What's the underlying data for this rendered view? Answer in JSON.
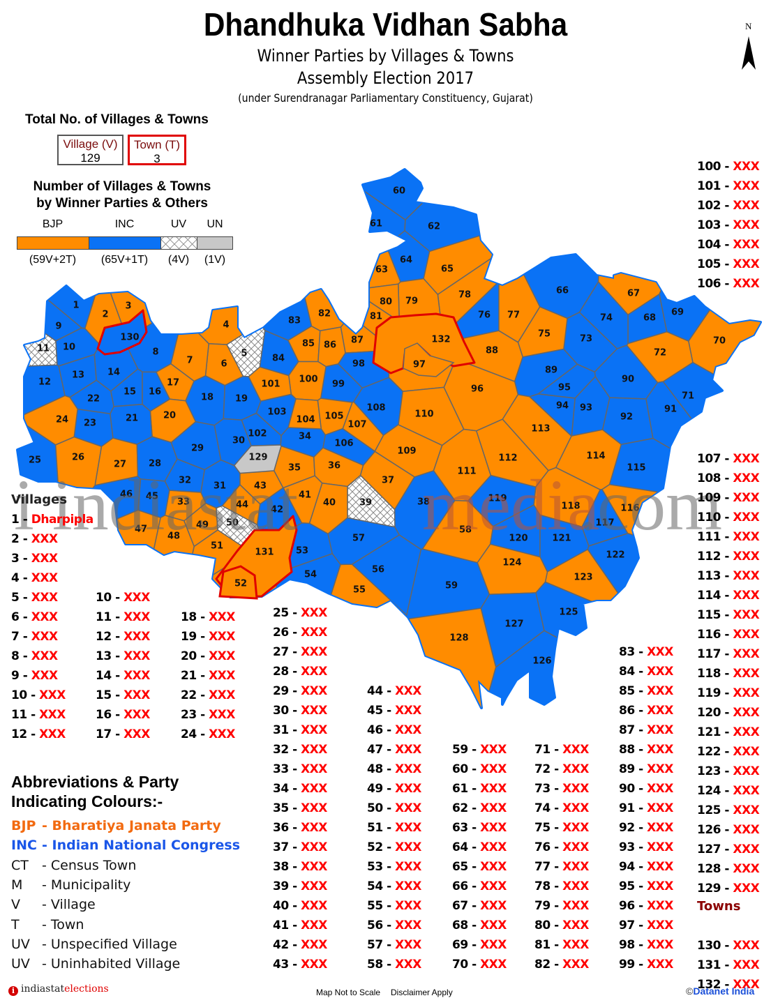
{
  "header": {
    "title": "Dhandhuka Vidhan Sabha",
    "subtitle1": "Winner Parties by Villages & Towns",
    "subtitle2": "Assembly Election 2017",
    "subtitle3": "(under Surendranagar Parliamentary Constituency, Gujarat)",
    "north_label": "N"
  },
  "totals": {
    "heading": "Total No. of Villages & Towns",
    "village_label": "Village (V)",
    "village_count": "129",
    "town_label": "Town (T)",
    "town_count": "3"
  },
  "party_summary": {
    "heading_line1": "Number of Villages & Towns",
    "heading_line2": "by Winner Parties & Others",
    "segments": [
      {
        "label": "BJP",
        "count": "(59V+2T)",
        "villages": 59,
        "towns": 2,
        "color": "#ff8c00",
        "pattern": "solid"
      },
      {
        "label": "INC",
        "count": "(65V+1T)",
        "villages": 65,
        "towns": 1,
        "color": "#0a72f5",
        "pattern": "solid"
      },
      {
        "label": "UV",
        "count": "(4V)",
        "villages": 4,
        "towns": 0,
        "color": "#ffffff",
        "pattern": "hatch"
      },
      {
        "label": "UN",
        "count": "(1V)",
        "villages": 1,
        "towns": 0,
        "color": "#c8c8c8",
        "pattern": "solid"
      }
    ]
  },
  "colors": {
    "BJP": "#ff8c00",
    "INC": "#0a72f5",
    "UV": "#ffffff",
    "UN": "#c8c8c8",
    "town_border": "#e00000",
    "region_border": "#666666",
    "outer_border": "#0a72f5"
  },
  "map": {
    "regions": [
      {
        "id": 1,
        "party": "INC"
      },
      {
        "id": 2,
        "party": "BJP"
      },
      {
        "id": 3,
        "party": "BJP"
      },
      {
        "id": 4,
        "party": "BJP"
      },
      {
        "id": 5,
        "party": "UV"
      },
      {
        "id": 6,
        "party": "BJP"
      },
      {
        "id": 7,
        "party": "BJP"
      },
      {
        "id": 8,
        "party": "INC"
      },
      {
        "id": 9,
        "party": "INC"
      },
      {
        "id": 10,
        "party": "INC"
      },
      {
        "id": 11,
        "party": "UV"
      },
      {
        "id": 12,
        "party": "INC"
      },
      {
        "id": 13,
        "party": "INC"
      },
      {
        "id": 14,
        "party": "INC"
      },
      {
        "id": 15,
        "party": "INC"
      },
      {
        "id": 16,
        "party": "INC"
      },
      {
        "id": 17,
        "party": "BJP"
      },
      {
        "id": 18,
        "party": "INC"
      },
      {
        "id": 19,
        "party": "INC"
      },
      {
        "id": 20,
        "party": "BJP"
      },
      {
        "id": 21,
        "party": "INC"
      },
      {
        "id": 22,
        "party": "INC"
      },
      {
        "id": 23,
        "party": "INC"
      },
      {
        "id": 24,
        "party": "BJP"
      },
      {
        "id": 25,
        "party": "INC"
      },
      {
        "id": 26,
        "party": "BJP"
      },
      {
        "id": 27,
        "party": "BJP"
      },
      {
        "id": 28,
        "party": "INC"
      },
      {
        "id": 29,
        "party": "INC"
      },
      {
        "id": 30,
        "party": "INC"
      },
      {
        "id": 31,
        "party": "INC"
      },
      {
        "id": 32,
        "party": "INC"
      },
      {
        "id": 33,
        "party": "BJP"
      },
      {
        "id": 34,
        "party": "INC"
      },
      {
        "id": 35,
        "party": "BJP"
      },
      {
        "id": 36,
        "party": "BJP"
      },
      {
        "id": 37,
        "party": "BJP"
      },
      {
        "id": 38,
        "party": "INC"
      },
      {
        "id": 39,
        "party": "UV"
      },
      {
        "id": 40,
        "party": "BJP"
      },
      {
        "id": 41,
        "party": "BJP"
      },
      {
        "id": 42,
        "party": "INC"
      },
      {
        "id": 43,
        "party": "BJP"
      },
      {
        "id": 44,
        "party": "BJP"
      },
      {
        "id": 45,
        "party": "INC"
      },
      {
        "id": 46,
        "party": "INC"
      },
      {
        "id": 47,
        "party": "BJP"
      },
      {
        "id": 48,
        "party": "BJP"
      },
      {
        "id": 49,
        "party": "BJP"
      },
      {
        "id": 50,
        "party": "UV"
      },
      {
        "id": 51,
        "party": "BJP"
      },
      {
        "id": 52,
        "party": "BJP"
      },
      {
        "id": 53,
        "party": "INC"
      },
      {
        "id": 54,
        "party": "INC"
      },
      {
        "id": 55,
        "party": "BJP"
      },
      {
        "id": 56,
        "party": "INC"
      },
      {
        "id": 57,
        "party": "INC"
      },
      {
        "id": 58,
        "party": "BJP"
      },
      {
        "id": 59,
        "party": "INC"
      },
      {
        "id": 60,
        "party": "INC"
      },
      {
        "id": 61,
        "party": "INC"
      },
      {
        "id": 62,
        "party": "INC"
      },
      {
        "id": 63,
        "party": "BJP"
      },
      {
        "id": 64,
        "party": "INC"
      },
      {
        "id": 65,
        "party": "BJP"
      },
      {
        "id": 66,
        "party": "INC"
      },
      {
        "id": 67,
        "party": "BJP"
      },
      {
        "id": 68,
        "party": "INC"
      },
      {
        "id": 69,
        "party": "INC"
      },
      {
        "id": 70,
        "party": "BJP"
      },
      {
        "id": 71,
        "party": "INC"
      },
      {
        "id": 72,
        "party": "BJP"
      },
      {
        "id": 73,
        "party": "INC"
      },
      {
        "id": 74,
        "party": "INC"
      },
      {
        "id": 75,
        "party": "BJP"
      },
      {
        "id": 76,
        "party": "INC"
      },
      {
        "id": 77,
        "party": "BJP"
      },
      {
        "id": 78,
        "party": "BJP"
      },
      {
        "id": 79,
        "party": "BJP"
      },
      {
        "id": 80,
        "party": "BJP"
      },
      {
        "id": 81,
        "party": "BJP"
      },
      {
        "id": 82,
        "party": "BJP"
      },
      {
        "id": 83,
        "party": "INC"
      },
      {
        "id": 84,
        "party": "INC"
      },
      {
        "id": 85,
        "party": "BJP"
      },
      {
        "id": 86,
        "party": "BJP"
      },
      {
        "id": 87,
        "party": "BJP"
      },
      {
        "id": 88,
        "party": "BJP"
      },
      {
        "id": 89,
        "party": "INC"
      },
      {
        "id": 90,
        "party": "INC"
      },
      {
        "id": 91,
        "party": "INC"
      },
      {
        "id": 92,
        "party": "INC"
      },
      {
        "id": 93,
        "party": "INC"
      },
      {
        "id": 94,
        "party": "INC"
      },
      {
        "id": 95,
        "party": "INC"
      },
      {
        "id": 96,
        "party": "BJP"
      },
      {
        "id": 97,
        "party": "BJP"
      },
      {
        "id": 98,
        "party": "INC"
      },
      {
        "id": 99,
        "party": "INC"
      },
      {
        "id": 100,
        "party": "BJP"
      },
      {
        "id": 101,
        "party": "BJP"
      },
      {
        "id": 102,
        "party": "INC"
      },
      {
        "id": 103,
        "party": "INC"
      },
      {
        "id": 104,
        "party": "BJP"
      },
      {
        "id": 105,
        "party": "BJP"
      },
      {
        "id": 106,
        "party": "INC"
      },
      {
        "id": 107,
        "party": "BJP"
      },
      {
        "id": 108,
        "party": "INC"
      },
      {
        "id": 109,
        "party": "BJP"
      },
      {
        "id": 110,
        "party": "BJP"
      },
      {
        "id": 111,
        "party": "BJP"
      },
      {
        "id": 112,
        "party": "BJP"
      },
      {
        "id": 113,
        "party": "BJP"
      },
      {
        "id": 114,
        "party": "BJP"
      },
      {
        "id": 115,
        "party": "INC"
      },
      {
        "id": 116,
        "party": "BJP"
      },
      {
        "id": 117,
        "party": "INC"
      },
      {
        "id": 118,
        "party": "BJP"
      },
      {
        "id": 119,
        "party": "INC"
      },
      {
        "id": 120,
        "party": "INC"
      },
      {
        "id": 121,
        "party": "INC"
      },
      {
        "id": 122,
        "party": "INC"
      },
      {
        "id": 123,
        "party": "BJP"
      },
      {
        "id": 124,
        "party": "BJP"
      },
      {
        "id": 125,
        "party": "INC"
      },
      {
        "id": 126,
        "party": "INC"
      },
      {
        "id": 127,
        "party": "INC"
      },
      {
        "id": 128,
        "party": "BJP"
      },
      {
        "id": 129,
        "party": "UN"
      },
      {
        "id": 130,
        "party": "INC",
        "type": "town"
      },
      {
        "id": 131,
        "party": "BJP",
        "type": "town"
      },
      {
        "id": 132,
        "party": "BJP",
        "type": "town"
      }
    ]
  },
  "village_list": {
    "heading": "Villages",
    "towns_heading": "Towns",
    "separator": " - ",
    "entries": [
      {
        "n": "1",
        "name": "Dharpipla"
      },
      {
        "n": "2",
        "name": "XXX"
      },
      {
        "n": "3",
        "name": "XXX"
      },
      {
        "n": "4",
        "name": "XXX"
      },
      {
        "n": "5",
        "name": "XXX"
      },
      {
        "n": "6",
        "name": "XXX"
      },
      {
        "n": "7",
        "name": "XXX"
      },
      {
        "n": "8",
        "name": "XXX"
      },
      {
        "n": "9",
        "name": "XXX"
      },
      {
        "n": "10",
        "name": "XXX"
      },
      {
        "n": "11",
        "name": "XXX"
      },
      {
        "n": "12",
        "name": "XXX"
      },
      {
        "n": "10",
        "name": "XXX"
      },
      {
        "n": "11",
        "name": "XXX"
      },
      {
        "n": "12",
        "name": "XXX"
      },
      {
        "n": "13",
        "name": "XXX"
      },
      {
        "n": "14",
        "name": "XXX"
      },
      {
        "n": "15",
        "name": "XXX"
      },
      {
        "n": "16",
        "name": "XXX"
      },
      {
        "n": "17",
        "name": "XXX"
      },
      {
        "n": "18",
        "name": "XXX"
      },
      {
        "n": "19",
        "name": "XXX"
      },
      {
        "n": "20",
        "name": "XXX"
      },
      {
        "n": "21",
        "name": "XXX"
      },
      {
        "n": "22",
        "name": "XXX"
      },
      {
        "n": "23",
        "name": "XXX"
      },
      {
        "n": "24",
        "name": "XXX"
      },
      {
        "n": "25",
        "name": "XXX"
      },
      {
        "n": "26",
        "name": "XXX"
      },
      {
        "n": "27",
        "name": "XXX"
      },
      {
        "n": "28",
        "name": "XXX"
      },
      {
        "n": "29",
        "name": "XXX"
      },
      {
        "n": "30",
        "name": "XXX"
      },
      {
        "n": "31",
        "name": "XXX"
      },
      {
        "n": "32",
        "name": "XXX"
      },
      {
        "n": "33",
        "name": "XXX"
      },
      {
        "n": "34",
        "name": "XXX"
      },
      {
        "n": "35",
        "name": "XXX"
      },
      {
        "n": "36",
        "name": "XXX"
      },
      {
        "n": "37",
        "name": "XXX"
      },
      {
        "n": "38",
        "name": "XXX"
      },
      {
        "n": "39",
        "name": "XXX"
      },
      {
        "n": "40",
        "name": "XXX"
      },
      {
        "n": "41",
        "name": "XXX"
      },
      {
        "n": "42",
        "name": "XXX"
      },
      {
        "n": "43",
        "name": "XXX"
      },
      {
        "n": "44",
        "name": "XXX"
      },
      {
        "n": "45",
        "name": "XXX"
      },
      {
        "n": "46",
        "name": "XXX"
      },
      {
        "n": "47",
        "name": "XXX"
      },
      {
        "n": "48",
        "name": "XXX"
      },
      {
        "n": "49",
        "name": "XXX"
      },
      {
        "n": "50",
        "name": "XXX"
      },
      {
        "n": "51",
        "name": "XXX"
      },
      {
        "n": "52",
        "name": "XXX"
      },
      {
        "n": "53",
        "name": "XXX"
      },
      {
        "n": "54",
        "name": "XXX"
      },
      {
        "n": "55",
        "name": "XXX"
      },
      {
        "n": "56",
        "name": "XXX"
      },
      {
        "n": "57",
        "name": "XXX"
      },
      {
        "n": "58",
        "name": "XXX"
      },
      {
        "n": "59",
        "name": "XXX"
      },
      {
        "n": "60",
        "name": "XXX"
      },
      {
        "n": "61",
        "name": "XXX"
      },
      {
        "n": "62",
        "name": "XXX"
      },
      {
        "n": "63",
        "name": "XXX"
      },
      {
        "n": "64",
        "name": "XXX"
      },
      {
        "n": "65",
        "name": "XXX"
      },
      {
        "n": "66",
        "name": "XXX"
      },
      {
        "n": "67",
        "name": "XXX"
      },
      {
        "n": "68",
        "name": "XXX"
      },
      {
        "n": "69",
        "name": "XXX"
      },
      {
        "n": "70",
        "name": "XXX"
      },
      {
        "n": "71",
        "name": "XXX"
      },
      {
        "n": "72",
        "name": "XXX"
      },
      {
        "n": "73",
        "name": "XXX"
      },
      {
        "n": "74",
        "name": "XXX"
      },
      {
        "n": "75",
        "name": "XXX"
      },
      {
        "n": "76",
        "name": "XXX"
      },
      {
        "n": "77",
        "name": "XXX"
      },
      {
        "n": "78",
        "name": "XXX"
      },
      {
        "n": "79",
        "name": "XXX"
      },
      {
        "n": "80",
        "name": "XXX"
      },
      {
        "n": "81",
        "name": "XXX"
      },
      {
        "n": "82",
        "name": "XXX"
      },
      {
        "n": "83",
        "name": "XXX"
      },
      {
        "n": "84",
        "name": "XXX"
      },
      {
        "n": "85",
        "name": "XXX"
      },
      {
        "n": "86",
        "name": "XXX"
      },
      {
        "n": "87",
        "name": "XXX"
      },
      {
        "n": "88",
        "name": "XXX"
      },
      {
        "n": "89",
        "name": "XXX"
      },
      {
        "n": "90",
        "name": "XXX"
      },
      {
        "n": "91",
        "name": "XXX"
      },
      {
        "n": "92",
        "name": "XXX"
      },
      {
        "n": "93",
        "name": "XXX"
      },
      {
        "n": "94",
        "name": "XXX"
      },
      {
        "n": "95",
        "name": "XXX"
      },
      {
        "n": "96",
        "name": "XXX"
      },
      {
        "n": "97",
        "name": "XXX"
      },
      {
        "n": "98",
        "name": "XXX"
      },
      {
        "n": "99",
        "name": "XXX"
      },
      {
        "n": "100",
        "name": "XXX"
      },
      {
        "n": "101",
        "name": "XXX"
      },
      {
        "n": "102",
        "name": "XXX"
      },
      {
        "n": "103",
        "name": "XXX"
      },
      {
        "n": "104",
        "name": "XXX"
      },
      {
        "n": "105",
        "name": "XXX"
      },
      {
        "n": "106",
        "name": "XXX"
      },
      {
        "n": "107",
        "name": "XXX"
      },
      {
        "n": "108",
        "name": "XXX"
      },
      {
        "n": "109",
        "name": "XXX"
      },
      {
        "n": "110",
        "name": "XXX"
      },
      {
        "n": "111",
        "name": "XXX"
      },
      {
        "n": "112",
        "name": "XXX"
      },
      {
        "n": "113",
        "name": "XXX"
      },
      {
        "n": "114",
        "name": "XXX"
      },
      {
        "n": "115",
        "name": "XXX"
      },
      {
        "n": "116",
        "name": "XXX"
      },
      {
        "n": "117",
        "name": "XXX"
      },
      {
        "n": "118",
        "name": "XXX"
      },
      {
        "n": "119",
        "name": "XXX"
      },
      {
        "n": "120",
        "name": "XXX"
      },
      {
        "n": "121",
        "name": "XXX"
      },
      {
        "n": "122",
        "name": "XXX"
      },
      {
        "n": "123",
        "name": "XXX"
      },
      {
        "n": "124",
        "name": "XXX"
      },
      {
        "n": "125",
        "name": "XXX"
      },
      {
        "n": "126",
        "name": "XXX"
      },
      {
        "n": "127",
        "name": "XXX"
      },
      {
        "n": "128",
        "name": "XXX"
      },
      {
        "n": "129",
        "name": "XXX"
      },
      {
        "n": "130",
        "name": "XXX"
      },
      {
        "n": "131",
        "name": "XXX"
      },
      {
        "n": "132",
        "name": "XXX"
      }
    ]
  },
  "abbreviations": {
    "heading_line1": "Abbreviations & Party",
    "heading_line2": "Indicating Colours:-",
    "items": [
      {
        "key": "BJP",
        "value": "- Bharatiya Janata Party",
        "color": "#f26a10"
      },
      {
        "key": "INC",
        "value": "- Indian National Congress",
        "color": "#1a56e8"
      },
      {
        "key": "CT",
        "value": "- Census Town",
        "color": "#111111"
      },
      {
        "key": "M",
        "value": "-  Municipality",
        "color": "#111111"
      },
      {
        "key": "V",
        "value": "- Village",
        "color": "#111111"
      },
      {
        "key": "T",
        "value": "- Town",
        "color": "#111111"
      },
      {
        "key": "UV",
        "value": "- Unspecified Village",
        "color": "#111111"
      },
      {
        "key": "UV",
        "value": "- Uninhabited Village",
        "color": "#111111"
      }
    ]
  },
  "footer": {
    "brand_part1": "indiastat",
    "brand_part2": "elections",
    "not_to_scale": "Map Not to Scale",
    "disclaimer": "Disclaimer Apply",
    "copyright_symbol": "©",
    "copyright": "Datanet India"
  },
  "watermark": {
    "part1": "i  indiastat",
    "part2": "media",
    "part3": ".com"
  }
}
